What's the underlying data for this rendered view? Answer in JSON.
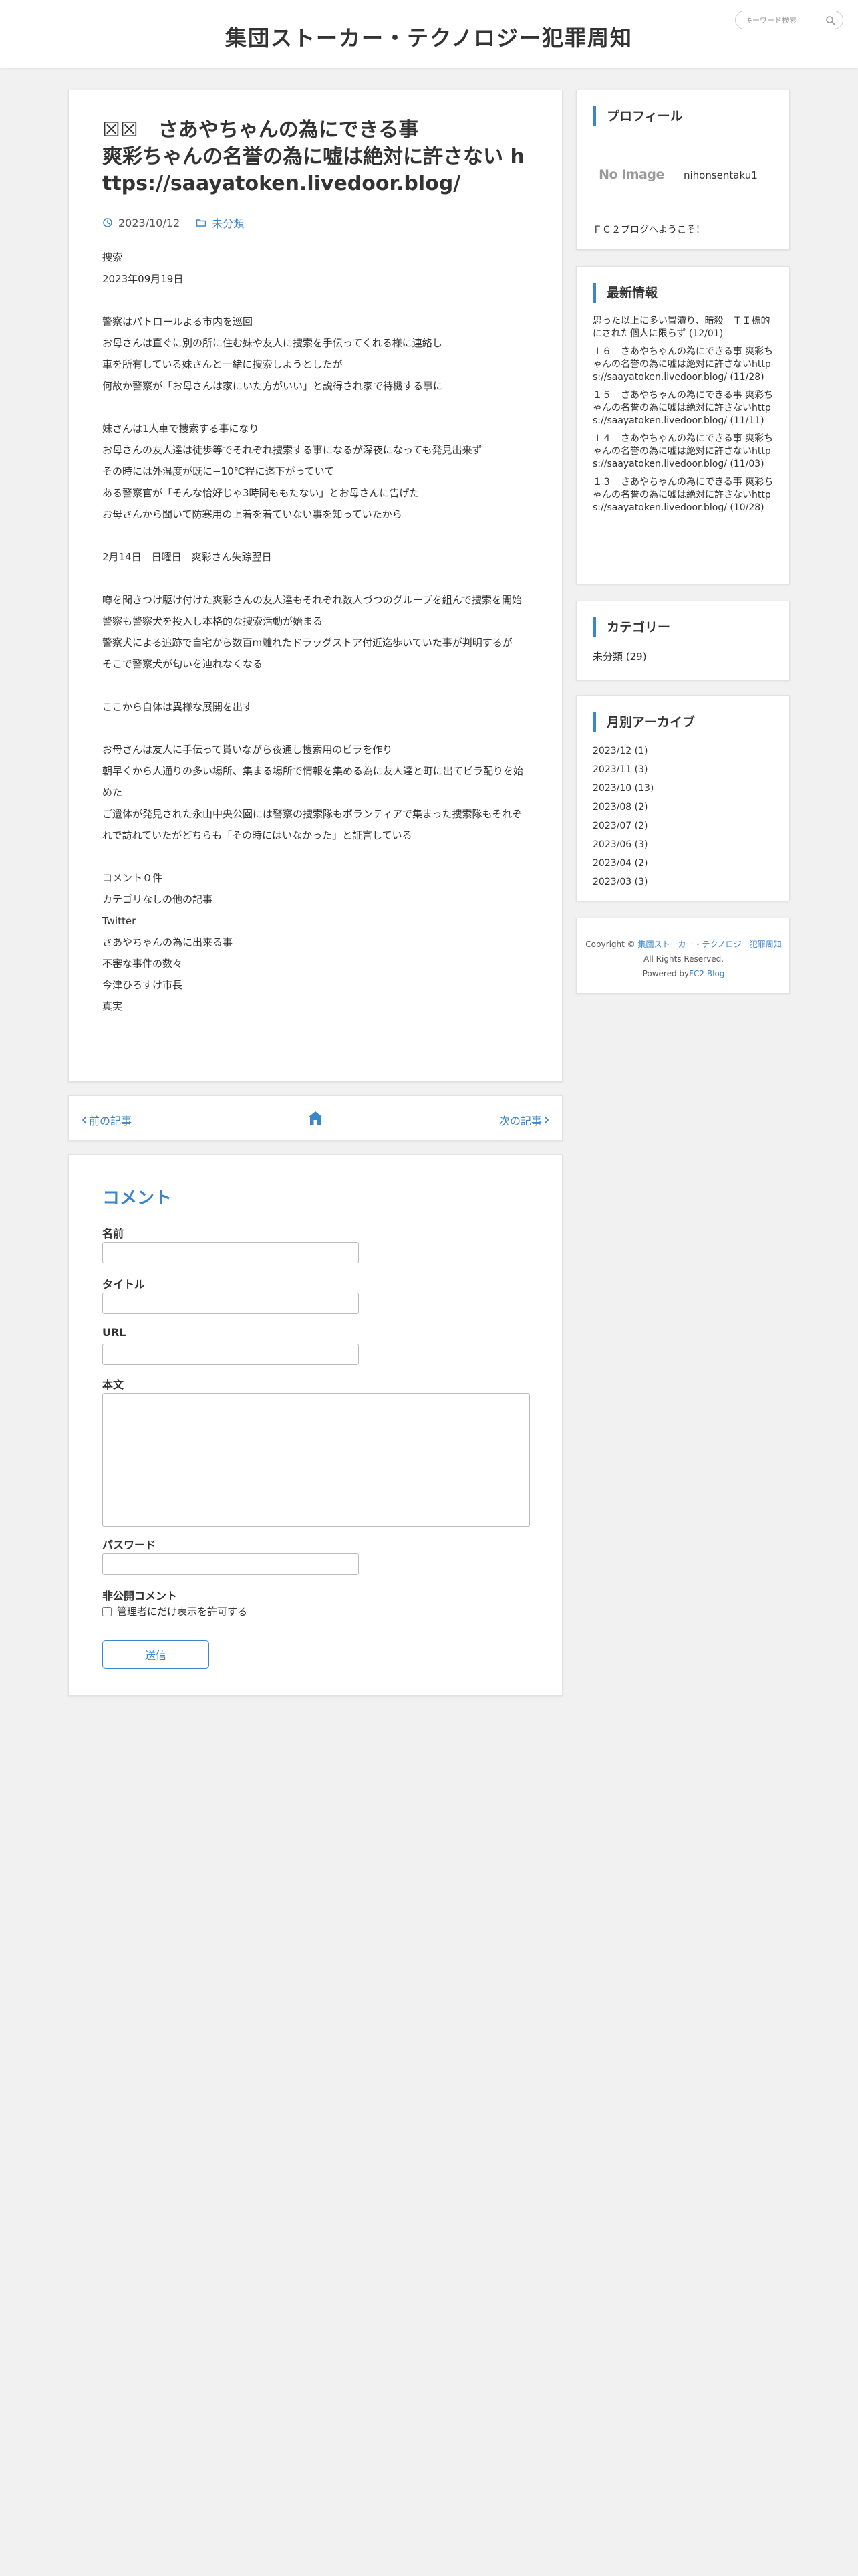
{
  "header": {
    "site_title": "集団ストーカー・テクノロジー犯罪周知",
    "search_placeholder": "キーワード検索"
  },
  "article": {
    "title_line1": "☒☒　さあやちゃんの為にできる事",
    "title_line2": "爽彩ちゃんの名誉の為に嘘は絶対に許さない https://saayatoken.livedoor.blog/",
    "date": "2023/10/12",
    "category": "未分類",
    "body": [
      "捜索",
      "2023年09月19日",
      "",
      "警察はパトロールよる市内を巡回",
      "お母さんは直ぐに別の所に住む妹や友人に捜索を手伝ってくれる様に連絡し",
      "車を所有している妹さんと一緒に捜索しようとしたが",
      "何故か警察が「お母さんは家にいた方がいい」と説得され家で待機する事に",
      "",
      "妹さんは1人車で捜索する事になり",
      "お母さんの友人達は徒歩等でそれぞれ捜索する事になるが深夜になっても発見出来ず",
      "その時には外温度が既に−10℃程に迄下がっていて",
      "ある警察官が「そんな恰好じゃ3時間ももたない」とお母さんに告げた",
      "お母さんから聞いて防寒用の上着を着ていない事を知っていたから",
      "",
      "2月14日　日曜日　爽彩さん失踪翌日",
      "",
      "噂を聞きつけ駆け付けた爽彩さんの友人達もそれぞれ数人づつのグループを組んで捜索を開始",
      "警察も警察犬を投入し本格的な捜索活動が始まる",
      "警察犬による追跡で自宅から数百m離れたドラッグストア付近迄歩いていた事が判明するが",
      "そこで警察犬が匂いを辿れなくなる",
      "",
      "ここから自体は異様な展開を出す",
      "",
      "お母さんは友人に手伝って貰いながら夜通し捜索用のビラを作り",
      "朝早くから人通りの多い場所、集まる場所で情報を集める為に友人達と町に出てビラ配りを始めた",
      "ご遺体が発見された永山中央公園には警察の捜索隊もボランティアで集まった捜索隊もそれぞれで訪れていたがどちらも「その時にはいなかった」と証言している",
      "",
      "コメント０件",
      "カテゴリなしの他の記事",
      "Twitter",
      "さあやちゃんの為に出来る事",
      "不審な事件の数々",
      "今津ひろすけ市長",
      "真実"
    ]
  },
  "pager": {
    "prev_label": "前の記事",
    "next_label": "次の記事"
  },
  "comment_form": {
    "heading": "コメント",
    "name_label": "名前",
    "title_label": "タイトル",
    "url_label": "URL",
    "body_label": "本文",
    "password_label": "パスワード",
    "private_label": "非公開コメント",
    "private_option": "管理者にだけ表示を許可する",
    "submit_label": "送信"
  },
  "sidebar": {
    "profile": {
      "title": "プロフィール",
      "image_text": "No Image",
      "name": "nihonsentaku1",
      "description": "ＦＣ２ブログへようこそ！"
    },
    "latest": {
      "title": "最新情報",
      "items": [
        "思った以上に多い冒瀆り、暗殺　ＴＩ標的にされた個人に限らず (12/01)",
        "１６　さあやちゃんの為にできる事 爽彩ちゃんの名誉の為に嘘は絶対に許さないhttps://saayatoken.livedoor.blog/ (11/28)",
        "１５　さあやちゃんの為にできる事 爽彩ちゃんの名誉の為に嘘は絶対に許さないhttps://saayatoken.livedoor.blog/ (11/11)",
        "１４　さあやちゃんの為にできる事 爽彩ちゃんの名誉の為に嘘は絶対に許さないhttps://saayatoken.livedoor.blog/ (11/03)",
        "１３　さあやちゃんの為にできる事 爽彩ちゃんの名誉の為に嘘は絶対に許さないhttps://saayatoken.livedoor.blog/ (10/28)"
      ]
    },
    "category": {
      "title": "カテゴリー",
      "item": "未分類 (29)"
    },
    "archive": {
      "title": "月別アーカイブ",
      "items": [
        "2023/12 (1)",
        "2023/11 (3)",
        "2023/10 (13)",
        "2023/08 (2)",
        "2023/07 (2)",
        "2023/06 (3)",
        "2023/04 (2)",
        "2023/03 (3)"
      ]
    },
    "copyright": {
      "prefix": "Copyright ©",
      "site_link": "集団ストーカー・テクノロジー犯罪周知",
      "rights": "All Rights Reserved.",
      "powered_prefix": "Powered by",
      "powered_link": "FC2 Blog"
    }
  },
  "colors": {
    "accent": "#3a86c8",
    "background": "#f1f1f1"
  }
}
